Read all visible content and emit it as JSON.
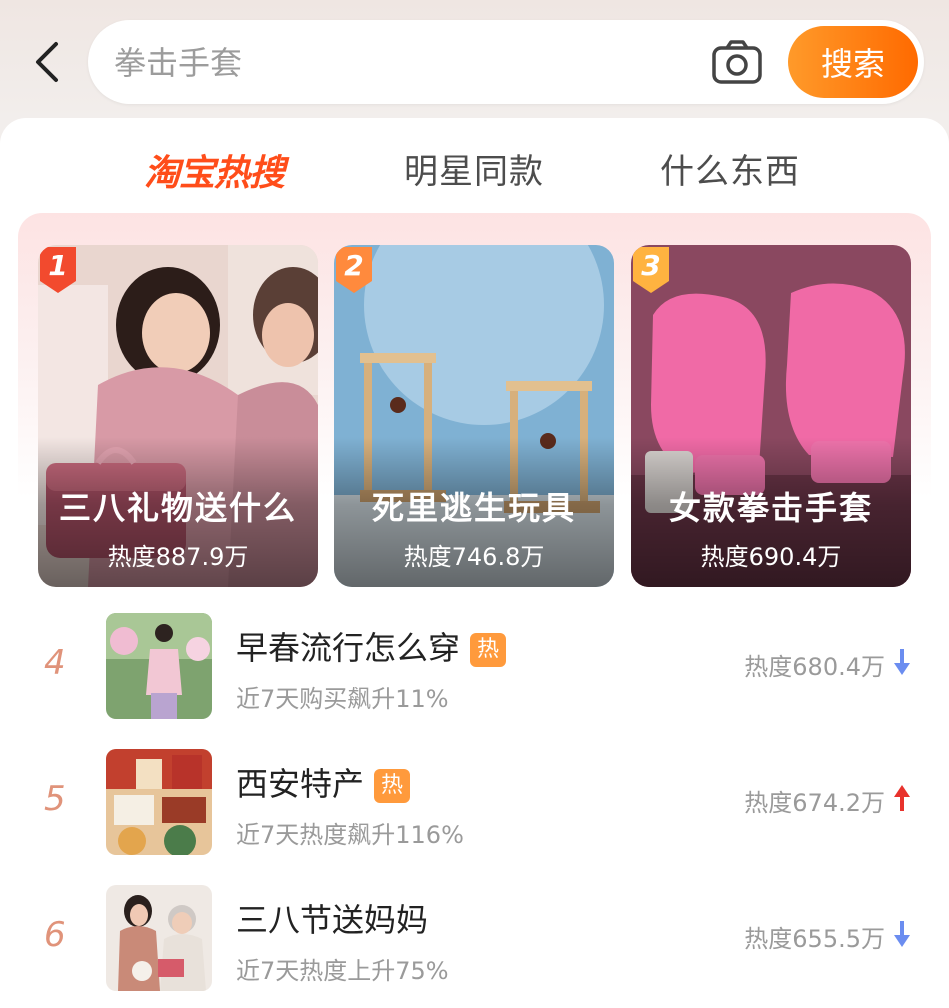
{
  "search": {
    "placeholder": "拳击手套",
    "button_label": "搜索"
  },
  "tabs": [
    {
      "label": "淘宝热搜",
      "active": true
    },
    {
      "label": "明星同款",
      "active": false
    },
    {
      "label": "什么东西",
      "active": false
    }
  ],
  "top_cards": [
    {
      "rank": "1",
      "title": "三八礼物送什么",
      "heat": "热度887.9万"
    },
    {
      "rank": "2",
      "title": "死里逃生玩具",
      "heat": "热度746.8万"
    },
    {
      "rank": "3",
      "title": "女款拳击手套",
      "heat": "热度690.4万"
    }
  ],
  "list": [
    {
      "rank": "4",
      "title": "早春流行怎么穿",
      "hot": "热",
      "sub": "近7天购买飙升11%",
      "heat": "热度680.4万",
      "trend": "down"
    },
    {
      "rank": "5",
      "title": "西安特产",
      "hot": "热",
      "sub": "近7天热度飙升116%",
      "heat": "热度674.2万",
      "trend": "up"
    },
    {
      "rank": "6",
      "title": "三八节送妈妈",
      "hot": "",
      "sub": "近7天热度上升75%",
      "heat": "热度655.5万",
      "trend": "down"
    }
  ],
  "colors": {
    "accent": "#ff6a00",
    "active_tab": "#ff4d1a",
    "trend_down": "#6b8df0",
    "trend_up": "#e8322c",
    "hot_tag": "#ff9a3c"
  }
}
